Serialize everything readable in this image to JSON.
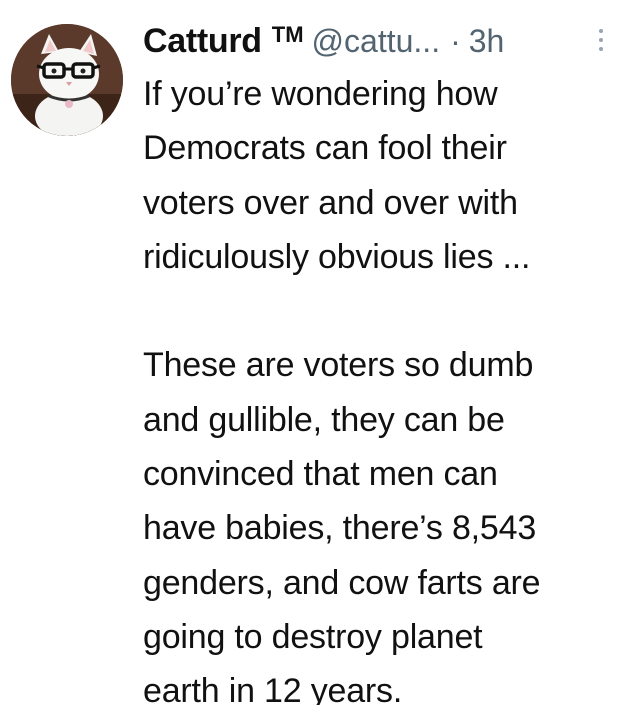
{
  "tweet": {
    "display_name": "Catturd",
    "badge": "TM",
    "handle": "@cattu...",
    "separator": "·",
    "time": "3h",
    "avatar_icon": "cat-with-glasses-avatar",
    "more_icon": "vertical-ellipsis-icon",
    "body": {
      "paragraph1": [
        "If you’re wondering how",
        "Democrats can fool their",
        "voters over and over with",
        "ridiculously obvious lies ..."
      ],
      "paragraph2": [
        "These are voters so dumb",
        "and gullible, they can be",
        "convinced that men can",
        "have babies, there’s 8,543",
        "genders, and cow farts are",
        "going to destroy planet",
        "earth in 12 years."
      ]
    }
  },
  "colors": {
    "text": "#111111",
    "muted": "#536471",
    "avatar_bg": "#5b3a2b"
  }
}
